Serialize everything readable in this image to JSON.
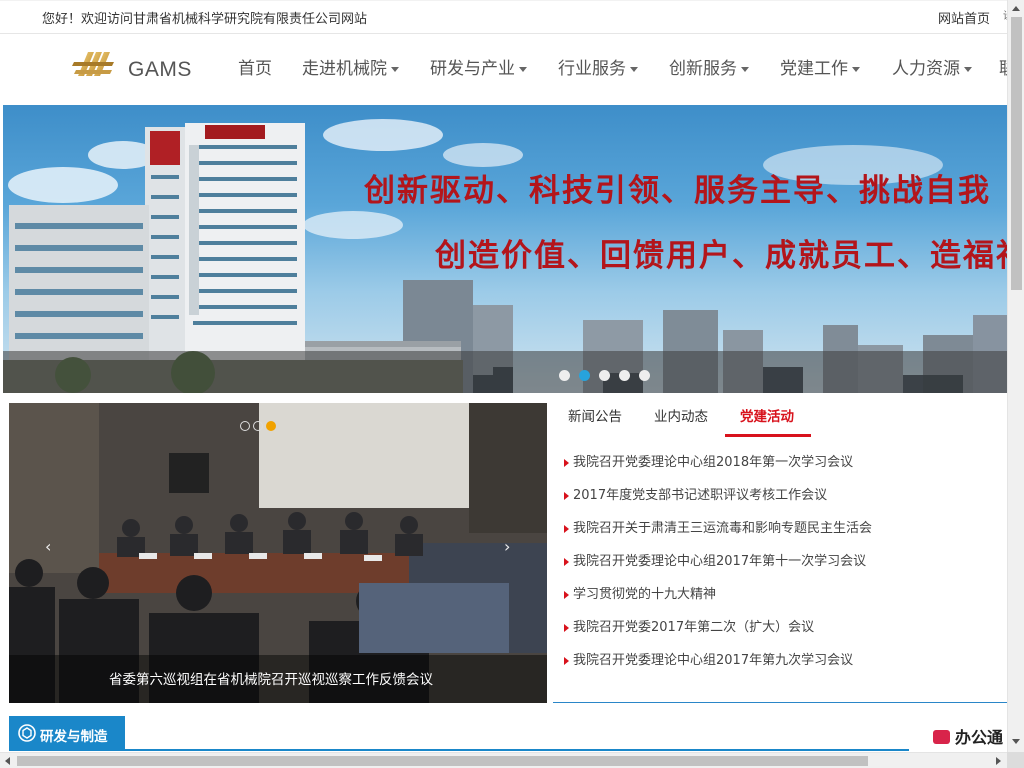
{
  "topbar": {
    "welcome": "您好！欢迎访问甘肃省机械科学研究院有限责任公司网站",
    "home_link": "网站首页",
    "more_link": "设"
  },
  "brand": {
    "logo_text": "GAMS"
  },
  "nav": {
    "items": [
      {
        "label": "首页"
      },
      {
        "label": "走进机械院"
      },
      {
        "label": "研发与产业"
      },
      {
        "label": "行业服务"
      },
      {
        "label": "创新服务"
      },
      {
        "label": "党建工作"
      },
      {
        "label": "人力资源"
      },
      {
        "label": "联"
      }
    ]
  },
  "banner": {
    "slogan_1": "创新驱动、科技引领、服务主导、挑战自我",
    "slogan_2": "创造价值、回馈用户、成就员工、造福社会",
    "slide_count": 5,
    "active_slide": 2
  },
  "photo_news": {
    "caption": "省委第六巡视组在省机械院召开巡视巡察工作反馈会议",
    "slide_count": 3,
    "active_slide": 3,
    "prev_arrow": "‹",
    "next_arrow": "›"
  },
  "tabs": {
    "items": [
      "新闻公告",
      "业内动态",
      "党建活动"
    ],
    "active": "党建活动"
  },
  "news_list": [
    "我院召开党委理论中心组2018年第一次学习会议",
    "2017年度党支部书记述职评议考核工作会议",
    "我院召开关于肃清王三运流毒和影响专题民主生活会",
    "我院召开党委理论中心组2017年第十一次学习会议",
    "学习贯彻党的十九大精神",
    "我院召开党委2017年第二次（扩大）会议",
    "我院召开党委理论中心组2017年第九次学习会议"
  ],
  "section": {
    "title": "研发与制造"
  },
  "office": {
    "label": "办公通"
  },
  "colors": {
    "accent_red": "#d8121c",
    "accent_blue": "#1a87c9",
    "slogan_red": "#b3151b",
    "active_dot": "#27a3dc",
    "photo_active_dot": "#f1a200"
  }
}
